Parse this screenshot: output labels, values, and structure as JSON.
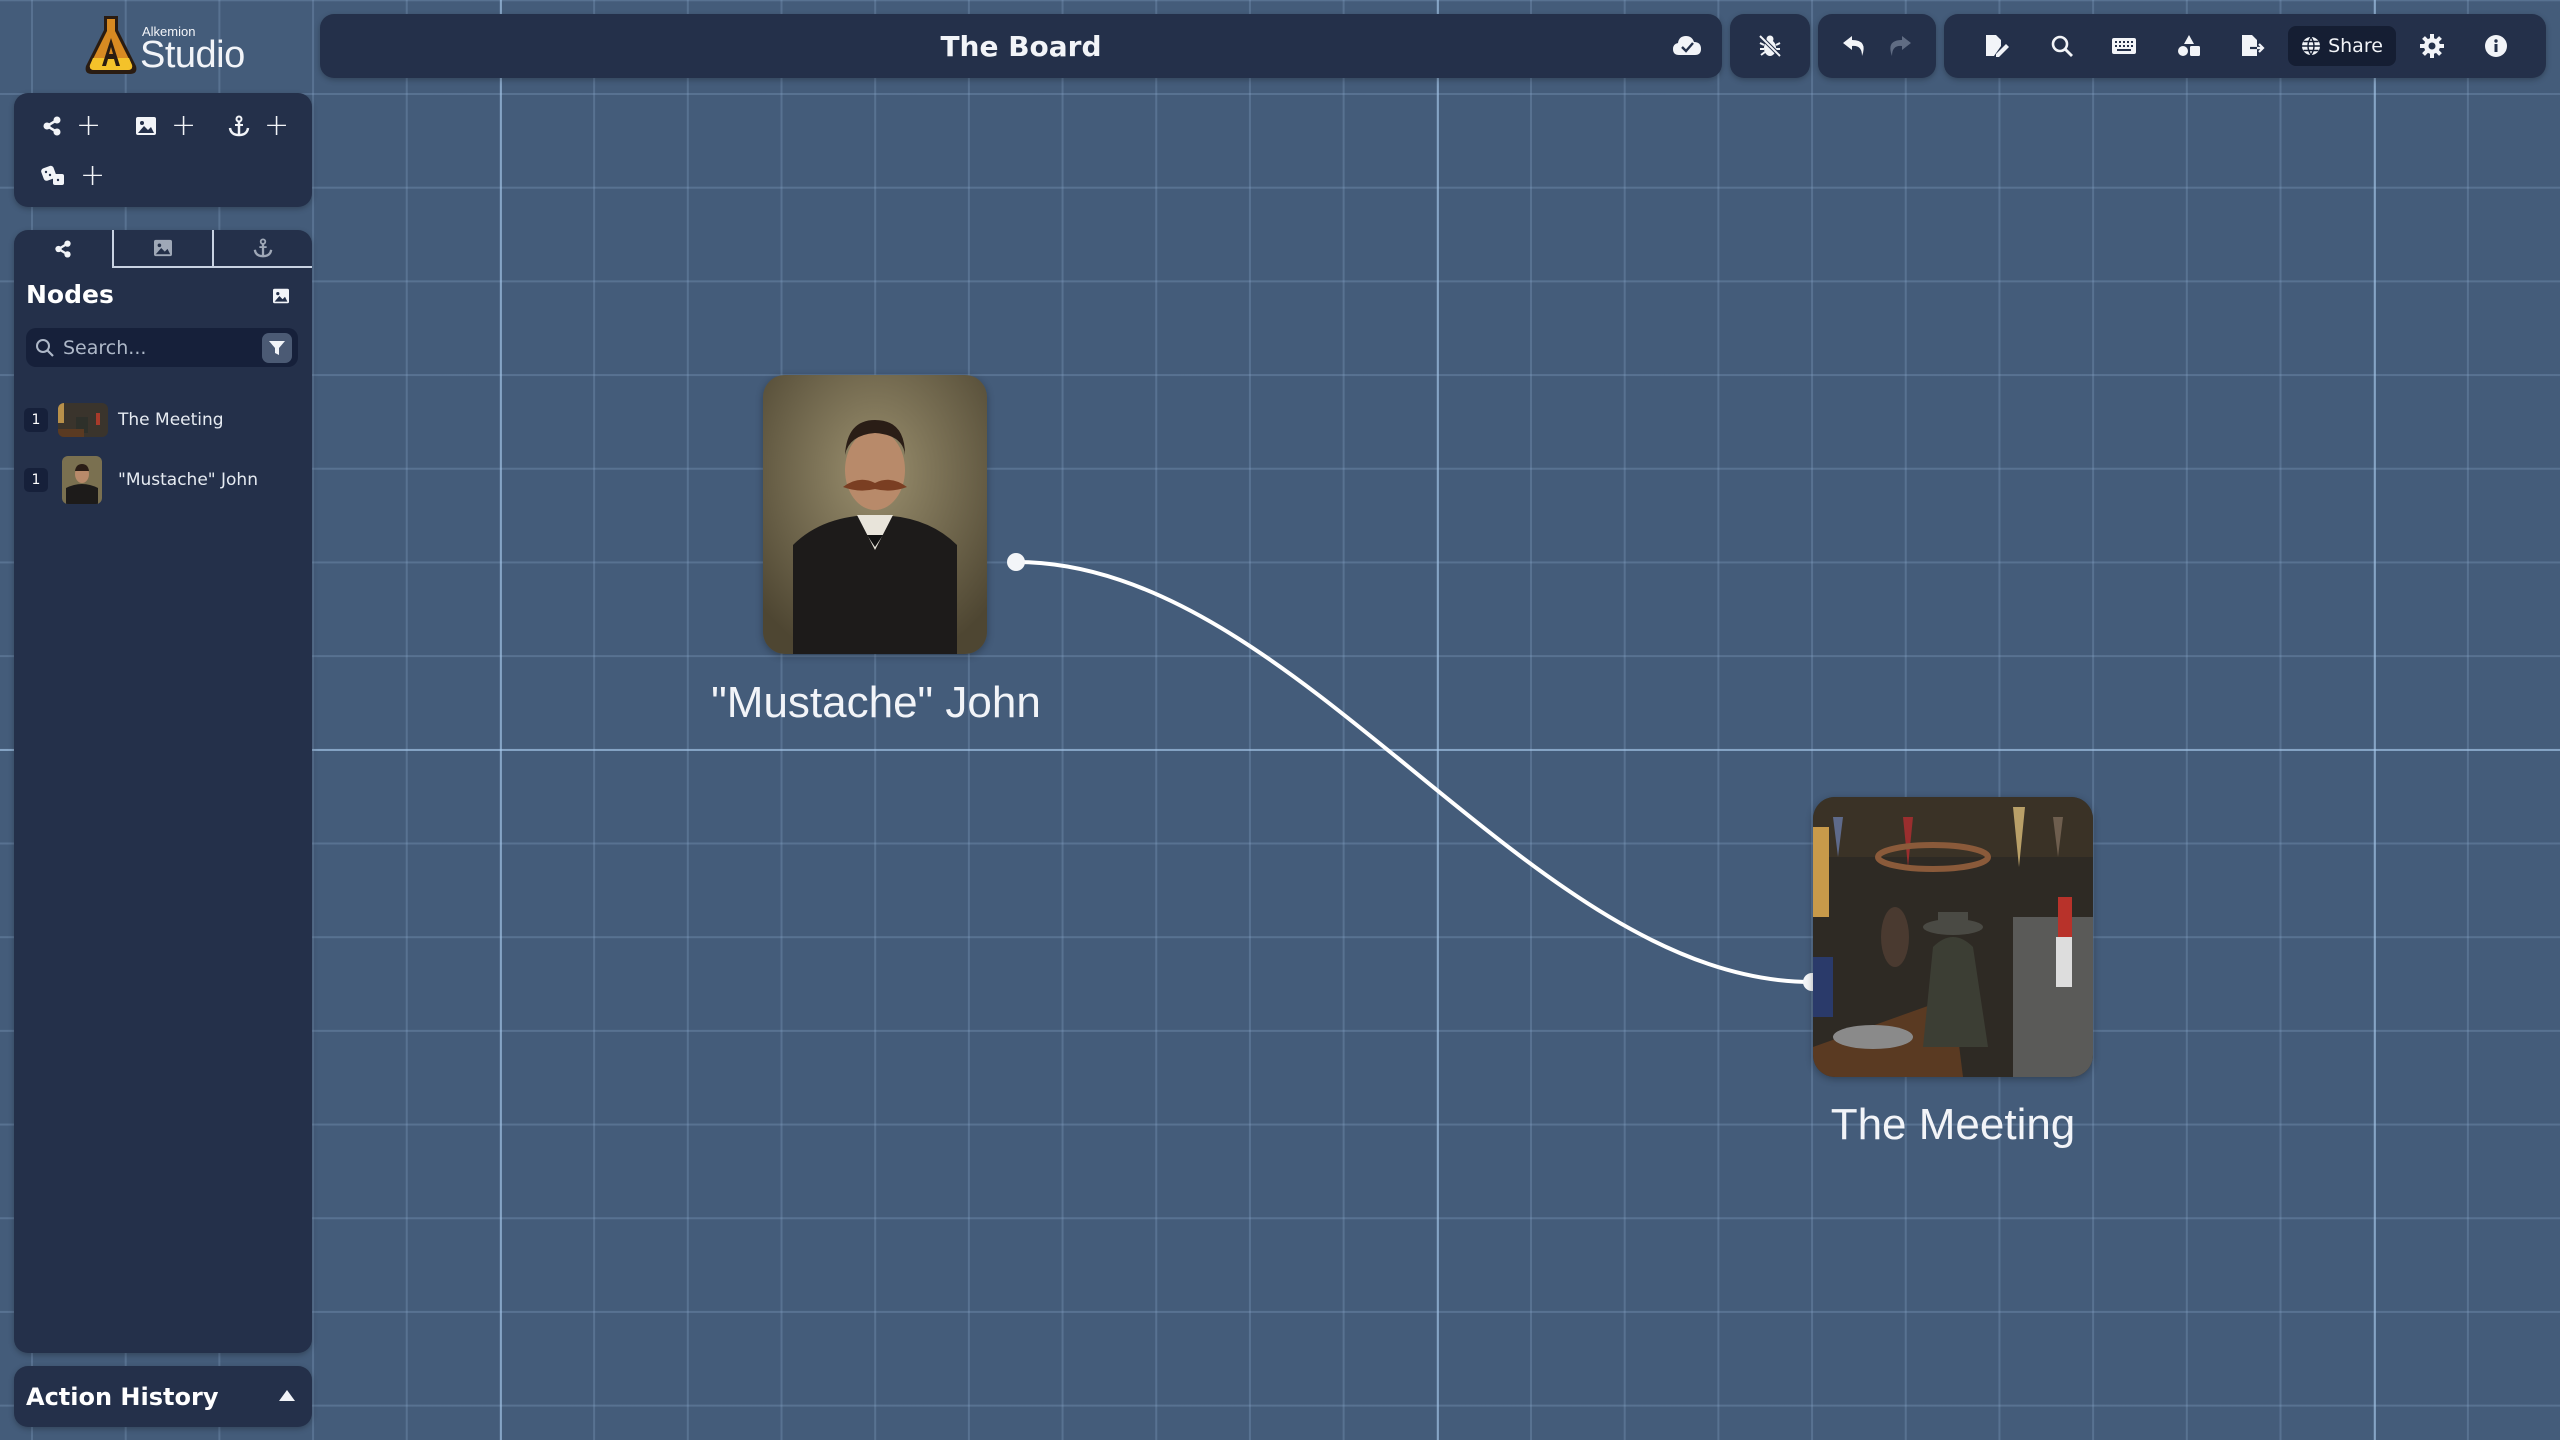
{
  "app": {
    "brand_small": "Alkemion",
    "brand_big": "Studio"
  },
  "toolbar": {
    "title": "The Board",
    "save_status_icon": "cloud-check-icon",
    "debug_icon": "bug-slash-icon",
    "undo_icon": "undo-icon",
    "redo_icon": "redo-icon",
    "right_icons": [
      "file-edit-icon",
      "search-icon",
      "keyboard-icon",
      "shapes-icon",
      "file-export-icon",
      "globe-icon",
      "gear-icon",
      "info-icon"
    ],
    "share_label": "Share"
  },
  "tool_panel": {
    "buttons": [
      {
        "icon": "node-share-icon",
        "label": "+"
      },
      {
        "icon": "image-icon",
        "label": "+"
      },
      {
        "icon": "anchor-icon",
        "label": "+"
      },
      {
        "icon": "dice-icon",
        "label": "+"
      }
    ]
  },
  "sidebar": {
    "tabs": [
      {
        "icon": "node-share-icon",
        "active": true
      },
      {
        "icon": "image-icon",
        "active": false
      },
      {
        "icon": "anchor-icon",
        "active": false
      }
    ],
    "section_title": "Nodes",
    "search": {
      "placeholder": "Search...",
      "value": ""
    },
    "items": [
      {
        "count": "1",
        "name": "The Meeting"
      },
      {
        "count": "1",
        "name": "\"Mustache\" John"
      }
    ]
  },
  "action_history": {
    "title": "Action History"
  },
  "board": {
    "nodes": [
      {
        "id": "john",
        "label": "\"Mustache\" John"
      },
      {
        "id": "meeting",
        "label": "The Meeting"
      }
    ],
    "edges": [
      {
        "from": "john",
        "to": "meeting"
      }
    ]
  },
  "colors": {
    "canvas": "#445c7a",
    "panel": "#24304a",
    "accent": "#f2a32a",
    "edge": "#ffffff"
  }
}
